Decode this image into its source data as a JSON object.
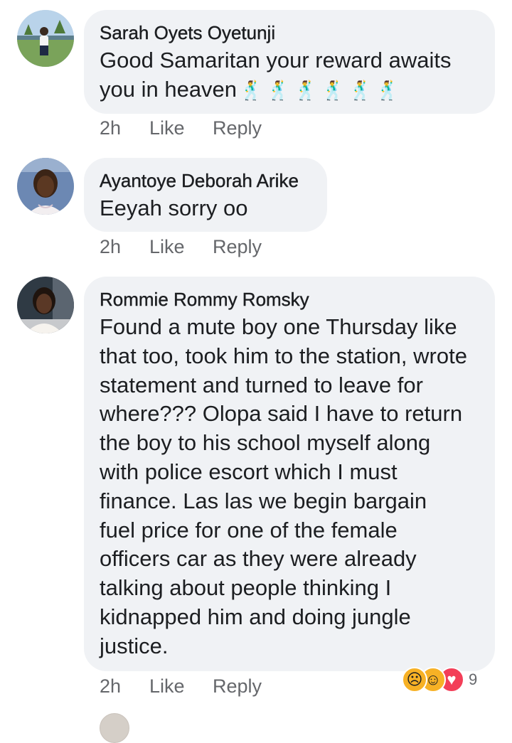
{
  "comments": [
    {
      "author": "Sarah Oyets Oyetunji",
      "text_line1": "Good Samaritan your reward awaits",
      "text_line2": "you in heaven",
      "emoji": "🕺🕺🕺🕺🕺🕺",
      "time": "2h",
      "like": "Like",
      "reply": "Reply"
    },
    {
      "author": "Ayantoye Deborah Arike",
      "text": "Eeyah sorry oo",
      "time": "2h",
      "like": "Like",
      "reply": "Reply"
    },
    {
      "author": "Rommie Rommy Romsky",
      "lines": [
        "Found a mute boy one Thursday like",
        "that too, took him to the station, wrote",
        "statement and turned to leave for",
        "where???  Olopa said I have to return",
        "the boy to his school myself along",
        "with police escort which I must",
        "finance. Las las we begin bargain",
        "fuel price for one of the female",
        "officers car as they were already",
        "talking about people thinking I",
        "kidnapped him and doing jungle",
        "justice."
      ],
      "time": "2h",
      "like": "Like",
      "reply": "Reply",
      "reactions": {
        "icons": [
          "sad-react-icon",
          "haha-react-icon",
          "love-react-icon"
        ],
        "count": "9"
      }
    }
  ],
  "colors": {
    "bubble": "#f0f2f5",
    "meta": "#65676b",
    "text": "#1c1e21",
    "love": "#f33e58",
    "yellow": "#f7b125"
  }
}
